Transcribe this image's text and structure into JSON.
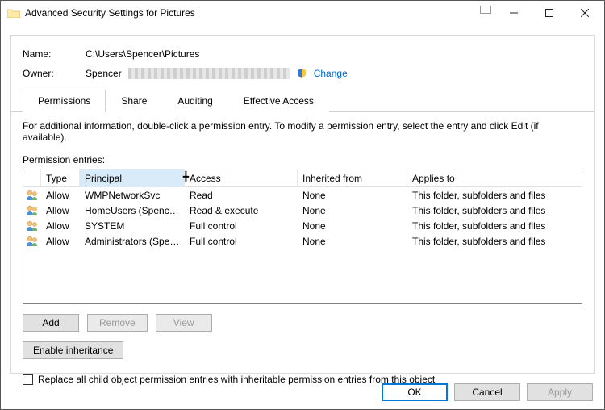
{
  "window": {
    "title": "Advanced Security Settings for Pictures"
  },
  "fields": {
    "nameLabel": "Name:",
    "nameValue": "C:\\Users\\Spencer\\Pictures",
    "ownerLabel": "Owner:",
    "ownerValue": "Spencer",
    "changeLink": "Change"
  },
  "tabs": {
    "permissions": "Permissions",
    "share": "Share",
    "auditing": "Auditing",
    "effective": "Effective Access"
  },
  "infoText": "For additional information, double-click a permission entry. To modify a permission entry, select the entry and click Edit (if available).",
  "entriesLabel": "Permission entries:",
  "columns": {
    "type": "Type",
    "principal": "Principal",
    "access": "Access",
    "inherited": "Inherited from",
    "applies": "Applies to"
  },
  "rows": [
    {
      "type": "Allow",
      "principal": "WMPNetworkSvc",
      "access": "Read",
      "inherited": "None",
      "applies": "This folder, subfolders and files"
    },
    {
      "type": "Allow",
      "principal": "HomeUsers (Spencer...",
      "access": "Read & execute",
      "inherited": "None",
      "applies": "This folder, subfolders and files"
    },
    {
      "type": "Allow",
      "principal": "SYSTEM",
      "access": "Full control",
      "inherited": "None",
      "applies": "This folder, subfolders and files"
    },
    {
      "type": "Allow",
      "principal": "Administrators (Spen...",
      "access": "Full control",
      "inherited": "None",
      "applies": "This folder, subfolders and files"
    }
  ],
  "buttons": {
    "add": "Add",
    "remove": "Remove",
    "view": "View",
    "enableInheritance": "Enable inheritance",
    "ok": "OK",
    "cancel": "Cancel",
    "apply": "Apply"
  },
  "checkboxLabel": "Replace all child object permission entries with inheritable permission entries from this object"
}
